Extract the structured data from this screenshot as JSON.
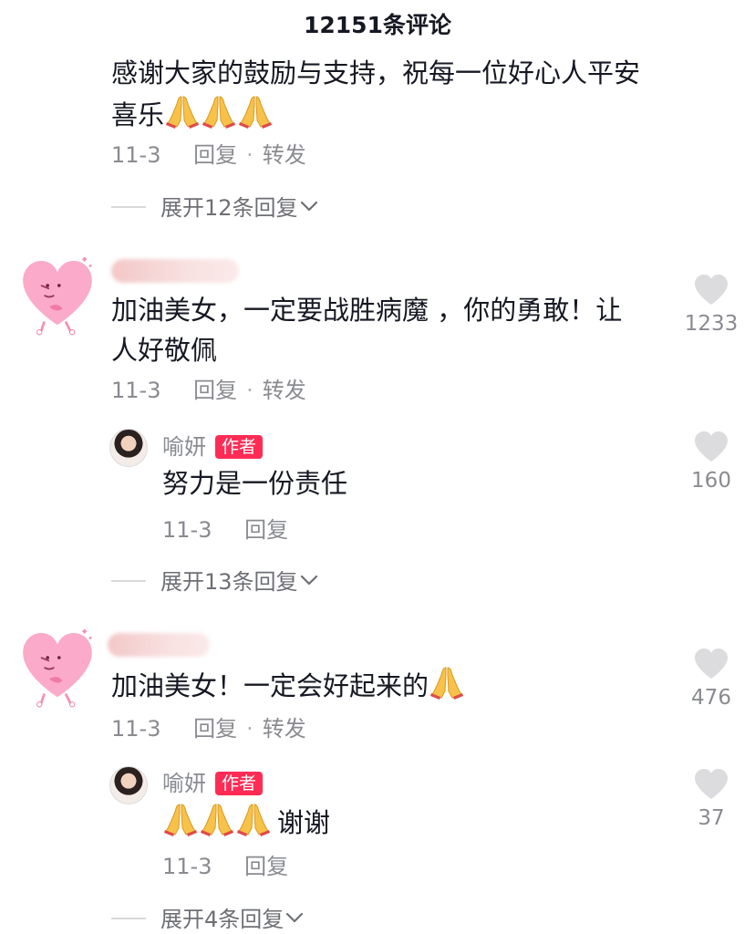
{
  "header": {
    "title": "12151条评论"
  },
  "comments": [
    {
      "text": "感谢大家的鼓励与支持，祝每一位好心人平安喜乐",
      "text_line1": "感谢大家的鼓励与支持，祝每一位好心人平安",
      "text_line2": "喜乐",
      "emoji": [
        "pray",
        "pray",
        "pray"
      ],
      "date": "11-3",
      "reply_label": "回复",
      "forward_label": "转发",
      "expand": "展开12条回复"
    },
    {
      "text_line1": "加油美女，一定要战胜病魔 ，你的勇敢！让",
      "text_line2": "人好敬佩",
      "date": "11-3",
      "reply_label": "回复",
      "forward_label": "转发",
      "likes": "1233",
      "reply": {
        "author": "喻妍",
        "badge": "作者",
        "text": "努力是一份责任",
        "date": "11-3",
        "reply_label": "回复",
        "likes": "160"
      },
      "expand": "展开13条回复"
    },
    {
      "text": "加油美女！一定会好起来的",
      "emoji": [
        "pray"
      ],
      "date": "11-3",
      "reply_label": "回复",
      "forward_label": "转发",
      "likes": "476",
      "reply": {
        "author": "喻妍",
        "badge": "作者",
        "emoji": [
          "pray",
          "pray",
          "pray"
        ],
        "text": "谢谢",
        "date": "11-3",
        "reply_label": "回复",
        "likes": "37"
      },
      "expand": "展开4条回复"
    }
  ],
  "colors": {
    "accent": "#fe2c55",
    "muted": "#8a8b91",
    "text": "#161823"
  }
}
